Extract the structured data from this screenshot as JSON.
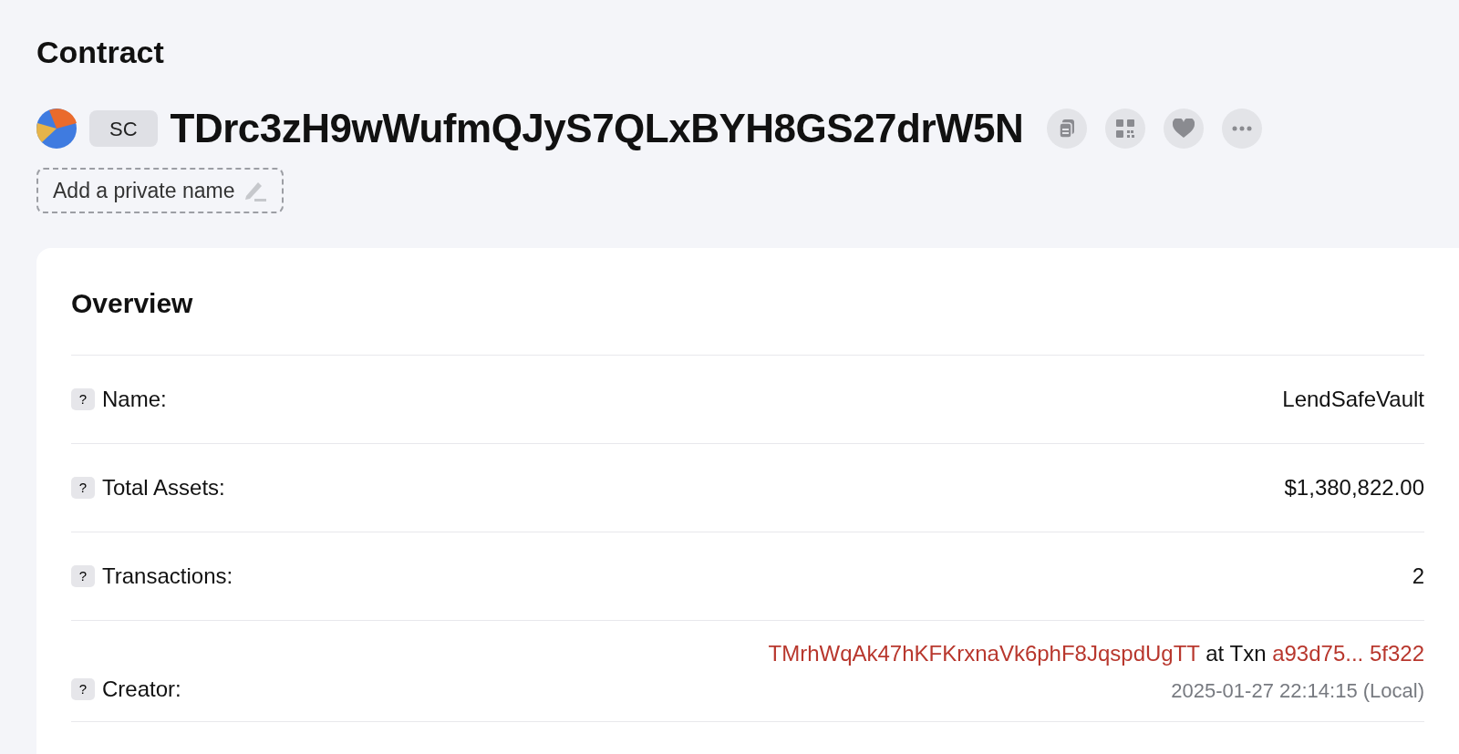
{
  "page_title": "Contract",
  "contract": {
    "badge": "SC",
    "address": "TDrc3zH9wWufmQJyS7QLxBYH8GS27drW5N",
    "private_name": "Add a private name"
  },
  "overview": {
    "title": "Overview",
    "help_mark": "?",
    "rows": [
      {
        "kind": "text",
        "label": "Name:",
        "value": "LendSafeVault"
      },
      {
        "kind": "text",
        "label": "Total Assets:",
        "value": "$1,380,822.00"
      },
      {
        "kind": "text",
        "label": "Transactions:",
        "value": "2"
      },
      {
        "kind": "creator",
        "label": "Creator:",
        "address": "TMrhWqAk47hKFKrxnaVk6phF8JqspdUgTT",
        "connector": "at Txn",
        "txn": "a93d75... 5f322",
        "time": "2025-01-27 22:14:15 (Local)"
      }
    ]
  }
}
